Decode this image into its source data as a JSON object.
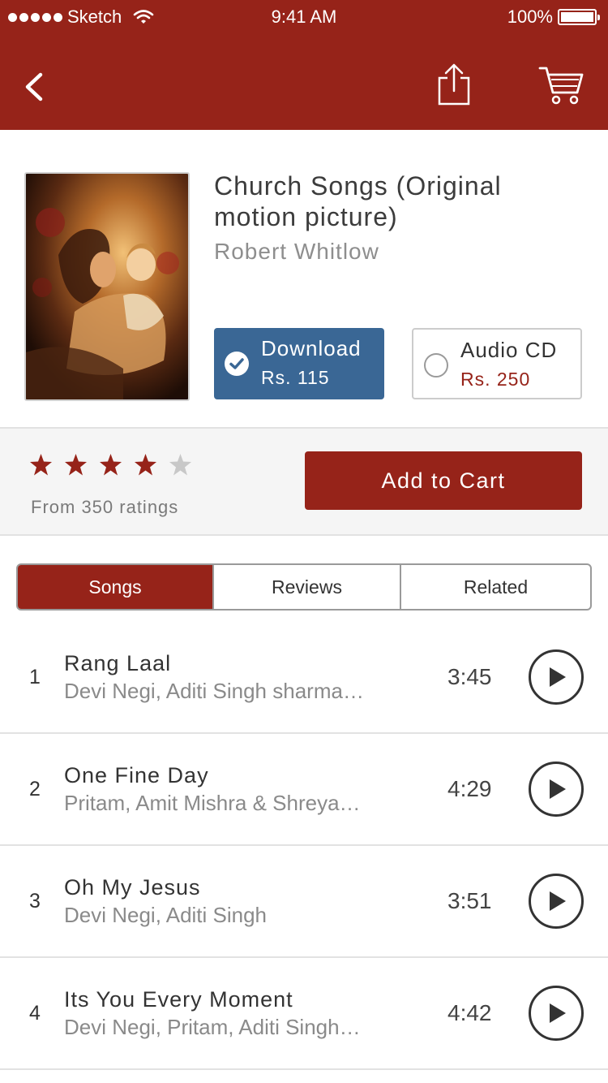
{
  "status_bar": {
    "carrier": "Sketch",
    "time": "9:41 AM",
    "battery": "100%"
  },
  "colors": {
    "brand": "#962319",
    "download_option": "#3a6795",
    "star_active": "#962319",
    "star_inactive": "#c8c8c8"
  },
  "nav": {
    "back_icon": "chevron-left-icon",
    "share_icon": "share-icon",
    "cart_icon": "shopping-cart-icon"
  },
  "album": {
    "title": "Church Songs (Original motion picture)",
    "artist": "Robert Whitlow",
    "options": [
      {
        "label": "Download",
        "price": "Rs. 115",
        "selected": true
      },
      {
        "label": "Audio CD",
        "price": "Rs. 250",
        "selected": false
      }
    ]
  },
  "rating": {
    "value": 4,
    "max": 5,
    "count_text": "From 350 ratings"
  },
  "cart": {
    "add_label": "Add to Cart"
  },
  "tabs": [
    {
      "label": "Songs",
      "active": true
    },
    {
      "label": "Reviews",
      "active": false
    },
    {
      "label": "Related",
      "active": false
    }
  ],
  "songs": [
    {
      "number": "1",
      "title": "Rang Laal",
      "artists": "Devi Negi, Aditi Singh sharma…",
      "duration": "3:45"
    },
    {
      "number": "2",
      "title": "One Fine Day",
      "artists": "Pritam, Amit Mishra & Shreya…",
      "duration": "4:29"
    },
    {
      "number": "3",
      "title": "Oh My Jesus",
      "artists": "Devi Negi, Aditi Singh",
      "duration": "3:51"
    },
    {
      "number": "4",
      "title": "Its You Every Moment",
      "artists": "Devi Negi, Pritam, Aditi Singh…",
      "duration": "4:42"
    }
  ]
}
